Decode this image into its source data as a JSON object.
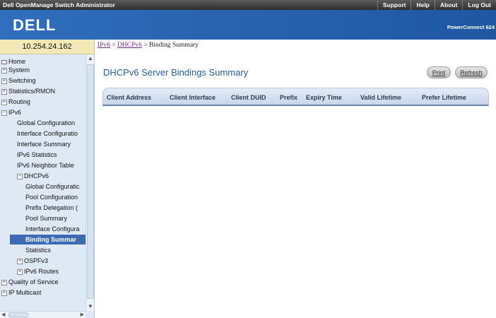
{
  "header": {
    "app_title": "Dell OpenManage Switch Administrator",
    "links": [
      "Support",
      "Help",
      "About",
      "Log Out"
    ],
    "product": "PowerConnect 624"
  },
  "logo": {
    "text": "DELL"
  },
  "device": {
    "ip": "10.254.24.162"
  },
  "breadcrumb": {
    "items": [
      "IPv6",
      "DHCPv6"
    ],
    "separator": ">",
    "current": "Binding Summary"
  },
  "nav": {
    "home": "Home",
    "system": "System",
    "switching": "Switching",
    "statistics_rmon": "Statistics/RMON",
    "routing": "Routing",
    "ipv6": "IPv6",
    "ipv6_children": [
      "Global Configuration",
      "Interface Configuratio",
      "Interface Summary",
      "IPv6 Statistics",
      "IPv6 Neighbor Table"
    ],
    "dhcpv6": "DHCPv6",
    "dhcpv6_children": [
      "Global Configuratic",
      "Pool Configuration",
      "Prefix Delegation (",
      "Pool Summary",
      "Interface Configura",
      "Binding Summar",
      "Statistics"
    ],
    "ospfv3": "OSPFv3",
    "ipv6_routes": "IPv6 Routes",
    "qos": "Quality of Service",
    "ip_multicast": "IP Multicast"
  },
  "page": {
    "title": "DHCPv6 Server Bindings Summary",
    "print_label": "Print",
    "refresh_label": "Refresh"
  },
  "table": {
    "columns": [
      "Client Address",
      "Client Interface",
      "Client DUID",
      "Prefix",
      "Expiry Time",
      "Valid Lifetime",
      "Prefer Lifetime"
    ],
    "rows": []
  },
  "colors": {
    "banner": "#2a64b1",
    "title": "#215ea8",
    "selected_nav": "#3d6bb3",
    "ip_box": "#f2e9b6"
  }
}
